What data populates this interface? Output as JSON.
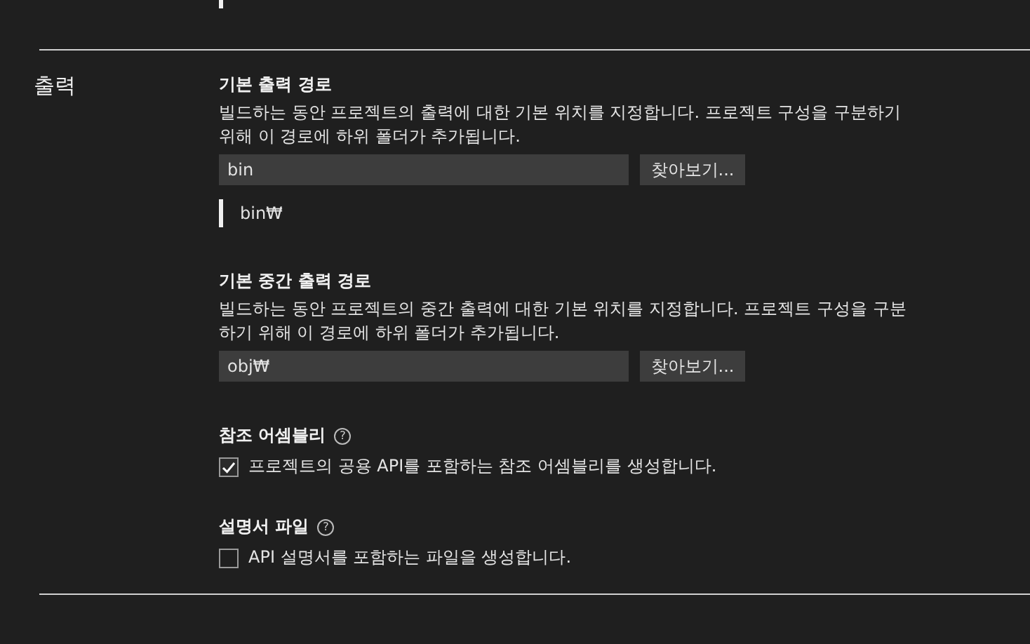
{
  "section": {
    "title": "출력"
  },
  "settings": [
    {
      "kind": "path",
      "title": "기본 출력 경로",
      "description": "빌드하는 동안 프로젝트의 출력에 대한 기본 위치를 지정합니다. 프로젝트 구성을 구분하기 위해 이 경로에 하위 폴더가 추가됩니다.",
      "value": "bin",
      "button": "찾아보기...",
      "preview": "bin₩"
    },
    {
      "kind": "path",
      "title": "기본 중간 출력 경로",
      "description": "빌드하는 동안 프로젝트의 중간 출력에 대한 기본 위치를 지정합니다. 프로젝트 구성을 구분하기 위해 이 경로에 하위 폴더가 추가됩니다.",
      "value": "obj₩",
      "button": "찾아보기..."
    },
    {
      "kind": "checkbox",
      "title": "참조 어셈블리",
      "help": "?",
      "checked": true,
      "label": "프로젝트의 공용 API를 포함하는 참조 어셈블리를 생성합니다."
    },
    {
      "kind": "checkbox",
      "title": "설명서 파일",
      "help": "?",
      "checked": false,
      "label": "API 설명서를 포함하는 파일을 생성합니다."
    }
  ]
}
